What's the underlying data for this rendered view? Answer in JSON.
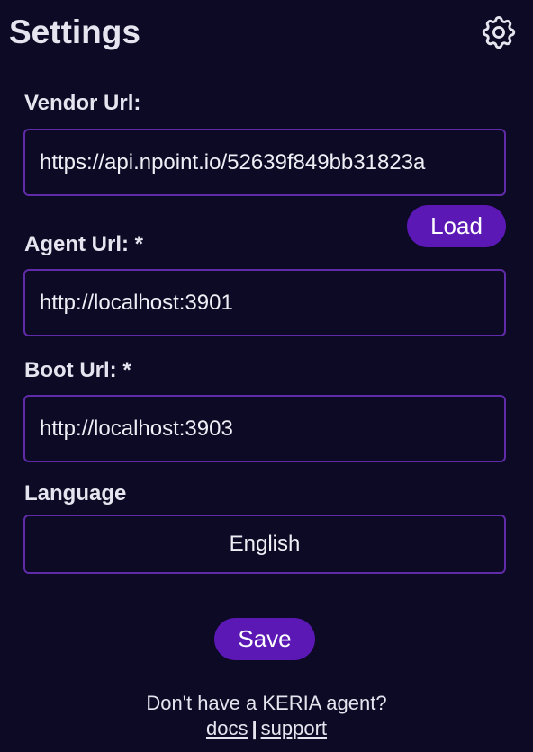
{
  "header": {
    "title": "Settings",
    "settings_icon": "gear-icon"
  },
  "form": {
    "vendor": {
      "label": "Vendor Url:",
      "value": "https://api.npoint.io/52639f849bb31823a",
      "load_label": "Load"
    },
    "agent": {
      "label": "Agent Url: *",
      "value": "http://localhost:3901"
    },
    "boot": {
      "label": "Boot Url: *",
      "value": "http://localhost:3903"
    },
    "language": {
      "label": "Language",
      "selected": "English"
    },
    "save_label": "Save"
  },
  "footer": {
    "question": "Don't have a KERIA agent?",
    "docs_label": "docs",
    "separator": "|",
    "support_label": "support"
  },
  "colors": {
    "background": "#0c0a25",
    "accent": "#5b18b5",
    "border": "#5f2ba8",
    "text": "#e6e4ee"
  }
}
